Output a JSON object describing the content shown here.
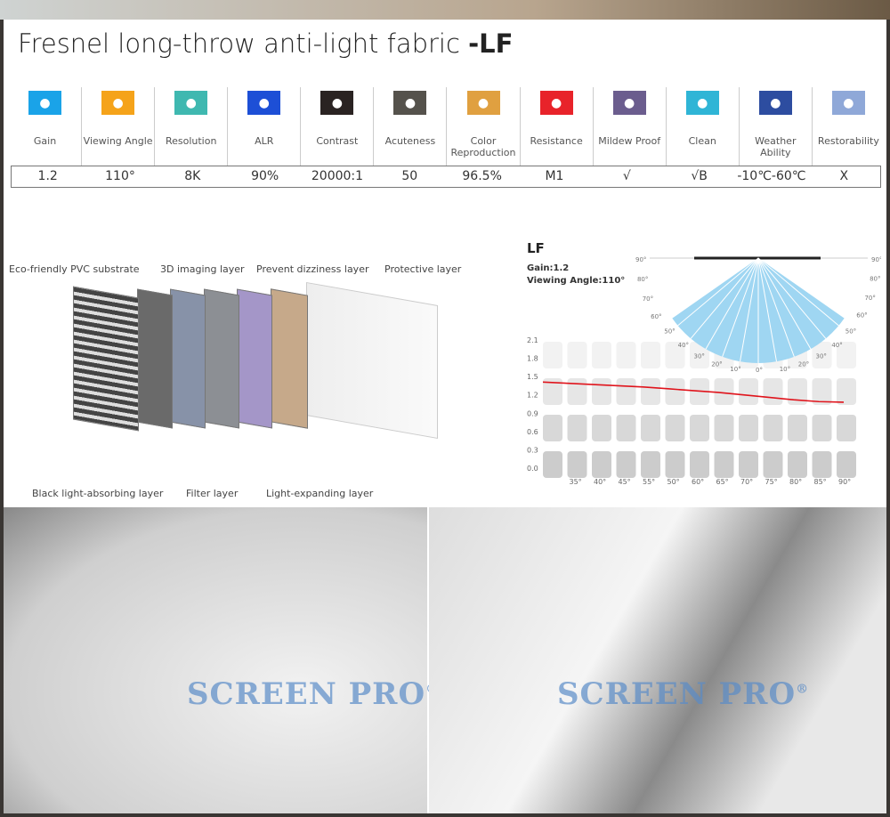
{
  "title": {
    "main": "Fresnel long-throw anti-light fabric ",
    "suffix": "-LF"
  },
  "specs": [
    {
      "label": "Gain",
      "value": "1.2",
      "icon": "sun-icon",
      "color": "#1aa3e8"
    },
    {
      "label": "Viewing Angle",
      "value": "110°",
      "icon": "eye-angle-icon",
      "color": "#f5a31a"
    },
    {
      "label": "Resolution",
      "value": "8K",
      "icon": "dot-triangle-icon",
      "color": "#3fb8b0"
    },
    {
      "label": "ALR",
      "value": "90%",
      "icon": "alr-icon",
      "color": "#1d4fd6"
    },
    {
      "label": "Contrast",
      "value": "20000:1",
      "icon": "contrast-icon",
      "color": "#2a2322"
    },
    {
      "label": "Acuteness",
      "value": "50",
      "icon": "acuteness-icon",
      "color": "#55524c"
    },
    {
      "label": "Color Reproduction",
      "value": "96.5%",
      "icon": "color-wheel-icon",
      "color": "#e0a040"
    },
    {
      "label": "Resistance",
      "value": "M1",
      "icon": "flame-icon",
      "color": "#e8232a"
    },
    {
      "label": "Mildew Proof",
      "value": "√",
      "icon": "droplet-icon",
      "color": "#6b5d8e"
    },
    {
      "label": "Clean",
      "value": "√B",
      "icon": "cleaning-icon",
      "color": "#2fb5d6"
    },
    {
      "label": "Weather Ability",
      "value": "-10℃-60℃",
      "icon": "thermometer-icon",
      "color": "#2d4da0"
    },
    {
      "label": "Restorability",
      "value": "X",
      "icon": "checkbox-window-icon",
      "color": "#8fa8d8"
    }
  ],
  "layers": {
    "top": [
      "Eco-friendly PVC substrate",
      "3D imaging layer",
      "Prevent dizziness layer",
      "Protective layer"
    ],
    "bottom": [
      "Black light-absorbing layer",
      "Filter layer",
      "Light-expanding layer"
    ]
  },
  "chart_data": {
    "type": "line",
    "title": "LF",
    "subtitle": [
      "Gain:1.2",
      "Viewing Angle:110°"
    ],
    "yticks": [
      "2.1",
      "1.8",
      "1.5",
      "1.2",
      "0.9",
      "0.6",
      "0.3",
      "0.0"
    ],
    "ylim": [
      0,
      2.1
    ],
    "xticks": [
      "35°",
      "40°",
      "45°",
      "55°",
      "50°",
      "60°",
      "65°",
      "70°",
      "75°",
      "80°",
      "85°",
      "90°"
    ],
    "series": [
      {
        "values": [
          1.41,
          1.39,
          1.37,
          1.35,
          1.33,
          1.3,
          1.27,
          1.24,
          1.2,
          1.16,
          1.12,
          1.09,
          1.08
        ]
      }
    ],
    "line_color": "#e0141c",
    "fan_left_labels": [
      "90°",
      "80°",
      "70°",
      "60°",
      "50°",
      "40°",
      "30°",
      "20°",
      "10°"
    ],
    "fan_center_label": "0°",
    "fan_right_labels": [
      "10°",
      "20°",
      "30°",
      "40°",
      "50°",
      "60°",
      "70°",
      "80°",
      "90°"
    ]
  },
  "watermark": {
    "text": "SCREEN PRO",
    "mark": "®"
  }
}
